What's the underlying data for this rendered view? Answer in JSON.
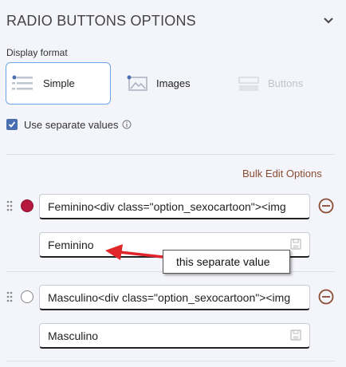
{
  "panel": {
    "title": "RADIO BUTTONS OPTIONS",
    "collapse_icon": "chevron-down-icon"
  },
  "display_format": {
    "label": "Display format",
    "options": [
      {
        "label": "Simple",
        "selected": true,
        "icon": "list-icon"
      },
      {
        "label": "Images",
        "selected": false,
        "icon": "image-icon"
      },
      {
        "label": "Buttons",
        "selected": false,
        "disabled": true,
        "icon": "buttons-icon"
      }
    ]
  },
  "separate_values": {
    "label": "Use separate values",
    "checked": true,
    "icon": "info-icon"
  },
  "bulk_edit_label": "Bulk Edit Options",
  "options": [
    {
      "label_value": "Feminino<div class=\"option_sexocartoon\"><img",
      "separate_value": "Feminino",
      "selected": true
    },
    {
      "label_value": "Masculino<div class=\"option_sexocartoon\"><img",
      "separate_value": "Masculino",
      "selected": false
    }
  ],
  "annotation": {
    "text": "this separate value"
  },
  "colors": {
    "accent_blue": "#4a6fb0",
    "selected_radio": "#b5183c",
    "bulk_edit": "#8a4b32",
    "remove_icon": "#8a4b32",
    "arrow": "#e0262a"
  }
}
